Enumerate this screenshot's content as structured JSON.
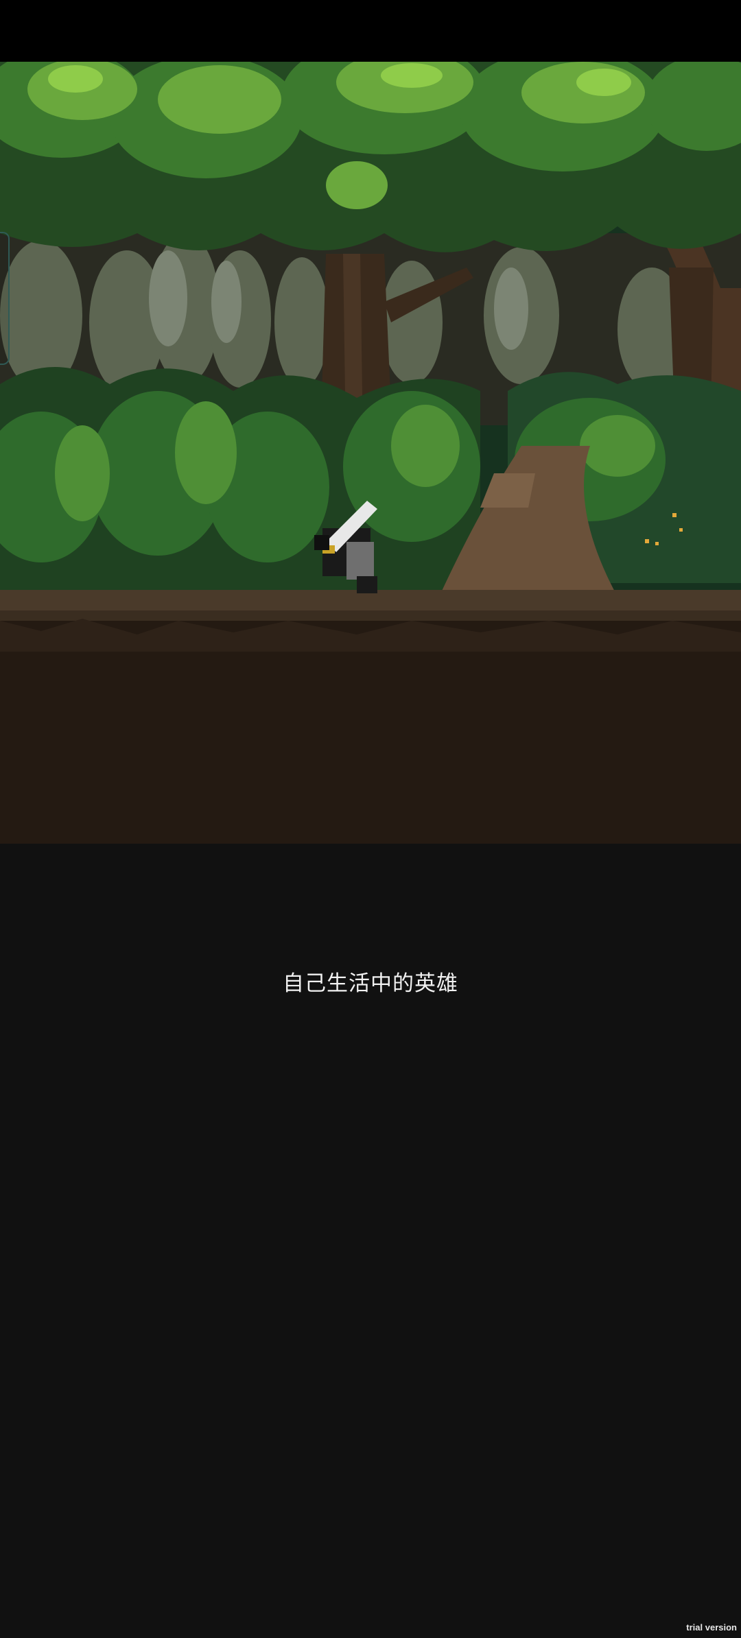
{
  "game": {
    "tagline": "自己生活中的英雄",
    "watermark": "trial version"
  },
  "colors": {
    "background": "#111111",
    "top_bar": "#000000",
    "dirt": "#241a12"
  }
}
